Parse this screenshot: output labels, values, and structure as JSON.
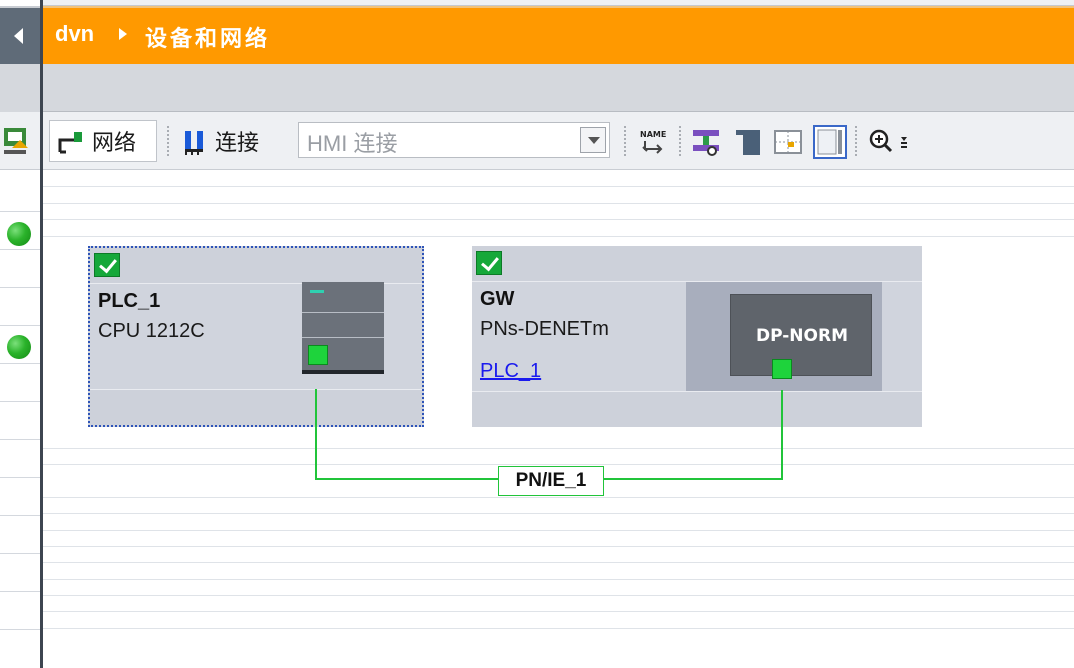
{
  "breadcrumb": {
    "project": "dvn",
    "current": "设备和网络"
  },
  "toolbar": {
    "network_label": "网络",
    "connections_label": "连接",
    "hmi_connection_value": "HMI 连接"
  },
  "devices": [
    {
      "name": "PLC_1",
      "type": "CPU 1212C",
      "status": "ok"
    },
    {
      "name": "GW",
      "type": "PNs-DENETm",
      "io_controller_link": "PLC_1",
      "module_label": "DP-NORM",
      "status": "ok"
    }
  ],
  "subnet": {
    "name": "PN/IE_1"
  },
  "colors": {
    "title_bar": "#ff9900",
    "subnet": "#21c43a",
    "status_ok": "#16a83a"
  }
}
